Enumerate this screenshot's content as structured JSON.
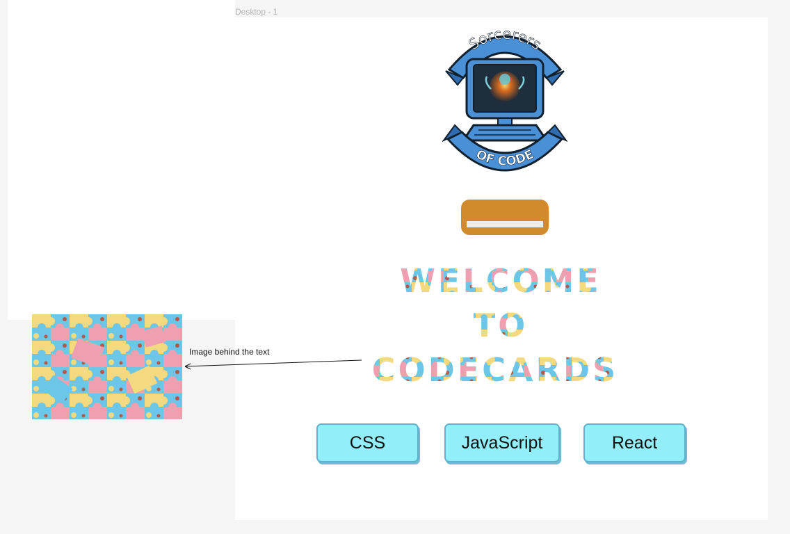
{
  "canvas": {
    "frame_label": "Desktop - 1"
  },
  "logo": {
    "top_text": "Sorcerers",
    "bottom_text": "OF CODE"
  },
  "hero": {
    "line1": "WELCOME",
    "line2": "TO",
    "line3": "CODECARDS"
  },
  "annotation": {
    "text": "Image behind the text"
  },
  "topics": {
    "css_label": "CSS",
    "js_label": "JavaScript",
    "react_label": "React"
  },
  "colors": {
    "logo_blue": "#4a90d6",
    "orange_button": "#d18b2c",
    "topic_button_bg": "#92eef8",
    "puzzle_blue": "#6cc6e8",
    "puzzle_yellow": "#f3d97f",
    "puzzle_pink": "#ee9fb0"
  },
  "icons": {
    "logo": "sorcerers-of-code-logo",
    "arrow": "arrow-left-icon"
  }
}
